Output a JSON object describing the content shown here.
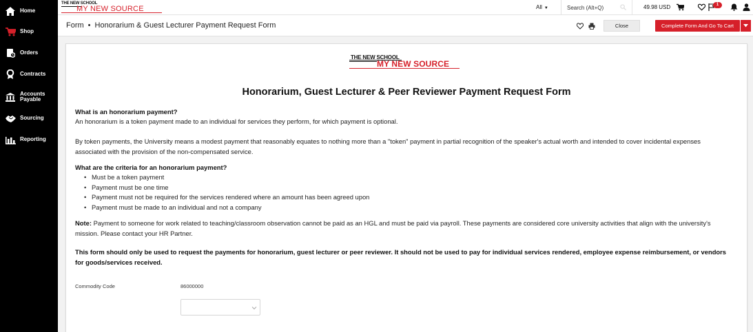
{
  "sidebar": {
    "items": [
      {
        "label": "Home",
        "icon": "home-icon"
      },
      {
        "label": "Shop",
        "icon": "cart-icon"
      },
      {
        "label": "Orders",
        "icon": "orders-icon"
      },
      {
        "label": "Contracts",
        "icon": "contracts-icon"
      },
      {
        "label": "Accounts Payable",
        "icon": "bank-icon"
      },
      {
        "label": "Sourcing",
        "icon": "sourcing-icon"
      },
      {
        "label": "Reporting",
        "icon": "reporting-icon"
      }
    ]
  },
  "topbar": {
    "logo_top": "THE NEW SCHOOL",
    "logo_main": "MY NEW SOURCE",
    "scope": "All",
    "search_placeholder": "Search (Alt+Q)",
    "cart_amount": "49.98 USD",
    "notification_count": "1"
  },
  "titlebar": {
    "crumb_root": "Form",
    "crumb_sep": "•",
    "crumb_title": "Honorarium & Guest Lecturer Payment Request Form",
    "close_label": "Close",
    "complete_label": "Complete Form And Go To Cart"
  },
  "form": {
    "logo_top": "THE NEW SCHOOL",
    "logo_main": "MY NEW SOURCE",
    "title": "Honorarium, Guest Lecturer & Peer Reviewer Payment Request Form",
    "q1": "What is an honorarium payment?",
    "a1": "An honorarium is a token payment made to an individual for services they perform, for which payment is optional.",
    "p2": "By token payments, the University means a modest payment that reasonably equates to nothing more than a \"token\" payment in partial recognition of the speaker's actual worth and intended to cover incidental expenses associated with the provision of the non-compensated service.",
    "q2": "What are the criteria for an honorarium payment?",
    "criteria": [
      "Must be a token payment",
      "Payment must be one time",
      "Payment must not be required for the services rendered where an amount has been agreed upon",
      "Payment must be made to an individual and not a company"
    ],
    "note_label": "Note:",
    "note_text": " Payment to someone for work related to teaching/classroom observation cannot be paid as an HGL and must be paid via payroll. These payments are considered core university activities that align with the university's mission. Please contact your HR Partner.",
    "warning": "This form should only be used to request the payments for honorarium, guest lecturer or peer reviewer. It should not be used to pay for individual services rendered, employee expense reimbursement, or vendors for goods/services received.",
    "commodity_label": "Commodity Code",
    "commodity_value": "86000000",
    "select_value": ""
  },
  "colors": {
    "brand_red": "#d6202a",
    "sidebar_bg": "#000000"
  }
}
